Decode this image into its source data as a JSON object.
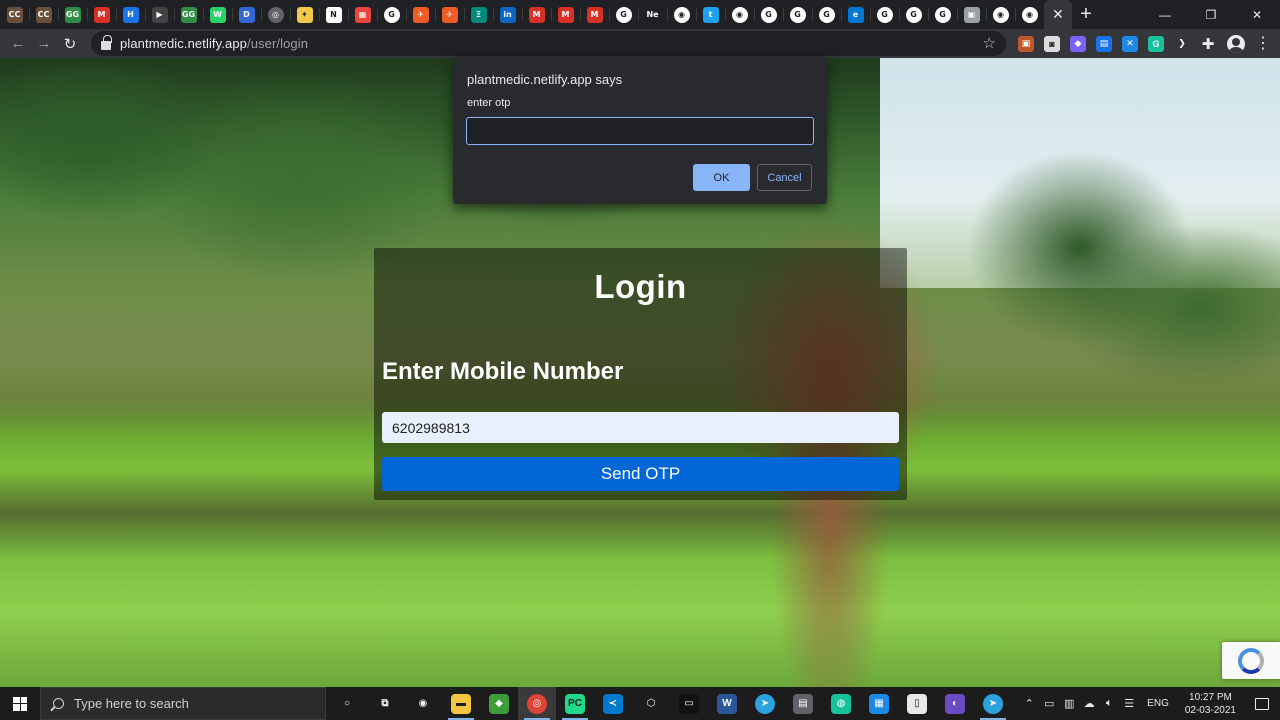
{
  "browser": {
    "tabs": [
      {
        "name": "tab-codechef-1",
        "glyph": "CC",
        "color": "#6b4f3a"
      },
      {
        "name": "tab-codechef-2",
        "glyph": "CC",
        "color": "#6b4f3a"
      },
      {
        "name": "tab-gfg-1",
        "glyph": "GG",
        "color": "#2f8d46"
      },
      {
        "name": "tab-gmail-1",
        "glyph": "M",
        "color": "#d93025"
      },
      {
        "name": "tab-site-1",
        "glyph": "H",
        "color": "#1a73e8"
      },
      {
        "name": "tab-video-1",
        "glyph": "▶",
        "color": "#444444"
      },
      {
        "name": "tab-gfg-2",
        "glyph": "GG",
        "color": "#2f8d46"
      },
      {
        "name": "tab-whatsapp",
        "glyph": "W",
        "color": "#25d366"
      },
      {
        "name": "tab-site-2",
        "glyph": "D",
        "color": "#3367d6"
      },
      {
        "name": "tab-site-3",
        "glyph": "◎",
        "color": "#5f6368"
      },
      {
        "name": "tab-bulb",
        "glyph": "✦",
        "color": "#f2c94c"
      },
      {
        "name": "tab-notion",
        "glyph": "N",
        "color": "#ffffff"
      },
      {
        "name": "tab-calendar",
        "glyph": "▦",
        "color": "#e8453c"
      },
      {
        "name": "tab-google-1",
        "glyph": "G",
        "color": "#ffffff"
      },
      {
        "name": "tab-postman-1",
        "glyph": "✈",
        "color": "#ef5b25"
      },
      {
        "name": "tab-postman-2",
        "glyph": "✈",
        "color": "#ef5b25"
      },
      {
        "name": "tab-site-4",
        "glyph": "Ξ",
        "color": "#00897b"
      },
      {
        "name": "tab-linkedin",
        "glyph": "in",
        "color": "#0a66c2"
      },
      {
        "name": "tab-gmail-2",
        "glyph": "M",
        "color": "#d93025"
      },
      {
        "name": "tab-gmail-3",
        "glyph": "M",
        "color": "#d93025"
      },
      {
        "name": "tab-gmail-4",
        "glyph": "M",
        "color": "#d93025"
      },
      {
        "name": "tab-google-2",
        "glyph": "G",
        "color": "#ffffff"
      },
      {
        "name": "tab-new-1",
        "glyph": "Ne",
        "color": "#202124"
      },
      {
        "name": "tab-github-1",
        "glyph": "◉",
        "color": "#ffffff"
      },
      {
        "name": "tab-twitter",
        "glyph": "t",
        "color": "#1da1f2"
      },
      {
        "name": "tab-github-2",
        "glyph": "◉",
        "color": "#ffffff"
      },
      {
        "name": "tab-google-3",
        "glyph": "G",
        "color": "#ffffff"
      },
      {
        "name": "tab-google-4",
        "glyph": "G",
        "color": "#ffffff"
      },
      {
        "name": "tab-google-5",
        "glyph": "G",
        "color": "#ffffff"
      },
      {
        "name": "tab-site-5",
        "glyph": "e",
        "color": "#0078d4"
      },
      {
        "name": "tab-google-6",
        "glyph": "G",
        "color": "#ffffff"
      },
      {
        "name": "tab-google-7",
        "glyph": "G",
        "color": "#ffffff"
      },
      {
        "name": "tab-google-8",
        "glyph": "G",
        "color": "#ffffff"
      },
      {
        "name": "tab-site-6",
        "glyph": "▣",
        "color": "#9aa0a6"
      },
      {
        "name": "tab-github-3",
        "glyph": "◉",
        "color": "#ffffff"
      },
      {
        "name": "tab-github-4",
        "glyph": "◉",
        "color": "#ffffff"
      }
    ],
    "new_tab_label": "+",
    "url_host": "plantmedic.netlify.app",
    "url_path": "/user/login",
    "extensions": [
      {
        "name": "ext-1",
        "glyph": "▣",
        "color": "#c0572b"
      },
      {
        "name": "ext-2",
        "glyph": "◙",
        "color": "#dddddd"
      },
      {
        "name": "ext-3",
        "glyph": "◆",
        "color": "#7b61ff"
      },
      {
        "name": "ext-4",
        "glyph": "▤",
        "color": "#1a73e8"
      },
      {
        "name": "ext-5",
        "glyph": "✕",
        "color": "#1e88e5"
      },
      {
        "name": "ext-6",
        "glyph": "G",
        "color": "#15c39a"
      },
      {
        "name": "ext-7",
        "glyph": "❯",
        "color": "#35363a"
      }
    ]
  },
  "dialog": {
    "title": "plantmedic.netlify.app says",
    "message": "enter otp",
    "input_value": "",
    "ok_label": "OK",
    "cancel_label": "Cancel"
  },
  "login": {
    "title": "Login",
    "label": "Enter Mobile Number",
    "mobile_value": "6202989813",
    "submit_label": "Send OTP"
  },
  "taskbar": {
    "search_placeholder": "Type here to search",
    "apps": [
      {
        "name": "cortana-icon",
        "glyph": "○",
        "color": "#1c1c1c",
        "running": false
      },
      {
        "name": "task-view-icon",
        "glyph": "⧉",
        "color": "#1c1c1c",
        "running": false
      },
      {
        "name": "github-desktop-icon",
        "glyph": "◉",
        "color": "#1c1c1c",
        "running": false
      },
      {
        "name": "file-explorer-icon",
        "glyph": "▬",
        "color": "#f4c542",
        "running": true
      },
      {
        "name": "git-icon",
        "glyph": "◆",
        "color": "#3e9c3a",
        "running": false
      },
      {
        "name": "chrome-icon",
        "glyph": "◎",
        "color": "#db4437",
        "running": true
      },
      {
        "name": "pycharm-icon",
        "glyph": "PC",
        "color": "#21d789",
        "running": true
      },
      {
        "name": "vscode-icon",
        "glyph": "≺",
        "color": "#007acc",
        "running": false
      },
      {
        "name": "box-icon",
        "glyph": "⬡",
        "color": "#1c1c1c",
        "running": false
      },
      {
        "name": "terminal-icon",
        "glyph": "▭",
        "color": "#111111",
        "running": false
      },
      {
        "name": "word-icon",
        "glyph": "W",
        "color": "#2b579a",
        "running": false
      },
      {
        "name": "telegram-icon-1",
        "glyph": "➤",
        "color": "#2aa3df",
        "running": false
      },
      {
        "name": "network-icon",
        "glyph": "▤",
        "color": "#5f6368",
        "running": false
      },
      {
        "name": "app-icon",
        "glyph": "◍",
        "color": "#15c39a",
        "running": false
      },
      {
        "name": "display-icon",
        "glyph": "▦",
        "color": "#1e88e5",
        "running": false
      },
      {
        "name": "notepad-icon",
        "glyph": "▯",
        "color": "#e8e8e8",
        "running": false
      },
      {
        "name": "media-icon",
        "glyph": "◐",
        "color": "#6a4bc4",
        "running": false
      },
      {
        "name": "telegram-icon-2",
        "glyph": "➤",
        "color": "#2aa3df",
        "running": true
      }
    ],
    "tray_icons": [
      "⌃",
      "▭",
      "▥",
      "☁",
      "🔈︎",
      "☰"
    ],
    "language": "ENG",
    "time": "10:27 PM",
    "date": "02-03-2021"
  }
}
